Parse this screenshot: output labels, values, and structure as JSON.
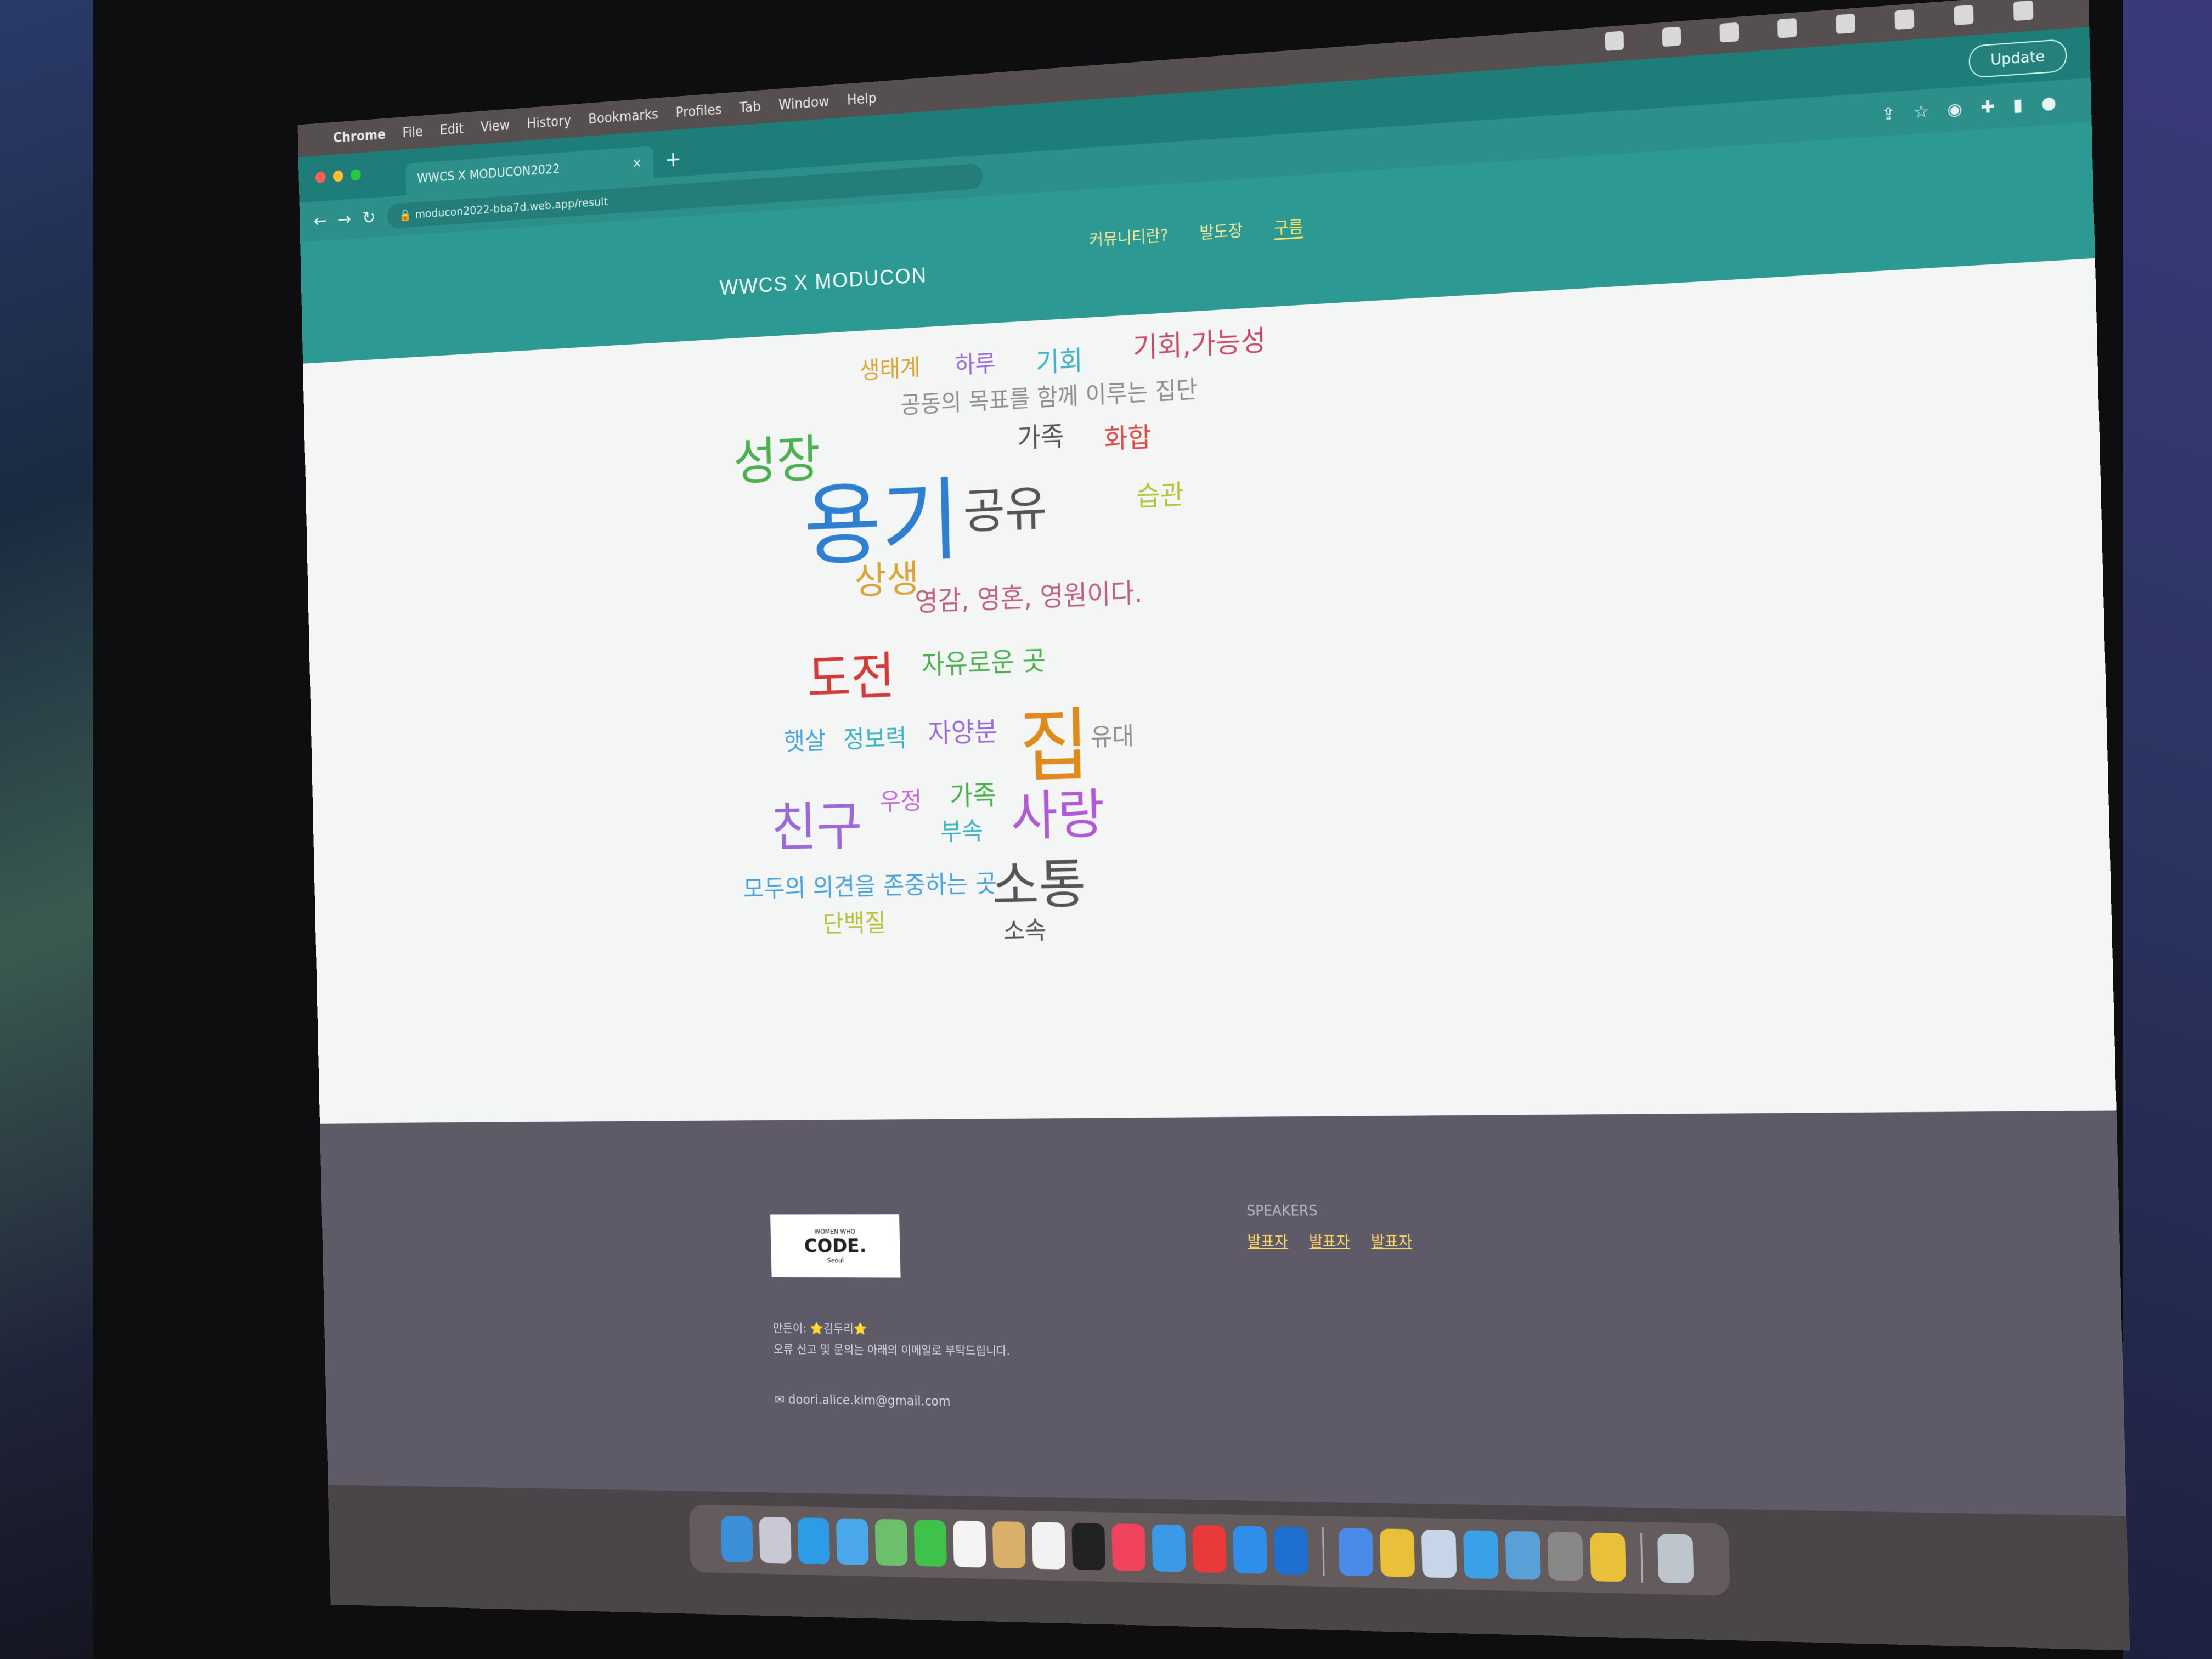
{
  "menubar": {
    "app_name": "Chrome",
    "items": [
      "File",
      "Edit",
      "View",
      "History",
      "Bookmarks",
      "Profiles",
      "Tab",
      "Window",
      "Help"
    ]
  },
  "browser": {
    "tab_title": "WWCS X MODUCON2022",
    "url": "moducon2022-bba7d.web.app/result",
    "update_label": "Update"
  },
  "site": {
    "title": "WWCS X MODUCON",
    "nav": [
      "커뮤니티란?",
      "발도장",
      "구름"
    ],
    "active_nav": "구름"
  },
  "word_cloud": [
    {
      "text": "생태계",
      "color": "#d9a53a"
    },
    {
      "text": "하루",
      "color": "#9b6ad6"
    },
    {
      "text": "기회",
      "color": "#3fb3c4"
    },
    {
      "text": "기회,가능성",
      "color": "#c84a6a"
    },
    {
      "text": "공동의 목표를 함께 이루는 집단",
      "color": "#8f8f8f"
    },
    {
      "text": "성장",
      "color": "#4caf50"
    },
    {
      "text": "용기",
      "color": "#2f7fd0"
    },
    {
      "text": "가족",
      "color": "#555555"
    },
    {
      "text": "화합",
      "color": "#d84a4a"
    },
    {
      "text": "공유",
      "color": "#555555"
    },
    {
      "text": "습관",
      "color": "#b8c23a"
    },
    {
      "text": "상생",
      "color": "#d9a53a"
    },
    {
      "text": "영감, 영혼, 영원이다.",
      "color": "#c0607a"
    },
    {
      "text": "도전",
      "color": "#d43a3a"
    },
    {
      "text": "자유로운 곳",
      "color": "#4caf50"
    },
    {
      "text": "햇살",
      "color": "#4aa3d9"
    },
    {
      "text": "정보력",
      "color": "#3fb3c4"
    },
    {
      "text": "자양분",
      "color": "#9b6ad6"
    },
    {
      "text": "집",
      "color": "#e08a1e"
    },
    {
      "text": "유대",
      "color": "#8f8f8f"
    },
    {
      "text": "친구",
      "color": "#9b6ad6"
    },
    {
      "text": "우정",
      "color": "#c46ad6"
    },
    {
      "text": "가족",
      "color": "#4caf50"
    },
    {
      "text": "사랑",
      "color": "#b05ad6"
    },
    {
      "text": "부속",
      "color": "#3fb3c4"
    },
    {
      "text": "모두의 의견을 존중하는 곳",
      "color": "#4aa3d9"
    },
    {
      "text": "소통",
      "color": "#555555"
    },
    {
      "text": "단백질",
      "color": "#b8c23a"
    },
    {
      "text": "소속",
      "color": "#555555"
    }
  ],
  "footer": {
    "logo_small": "WOMEN WHO",
    "logo_big": "CODE.",
    "logo_sub": "Seoul",
    "speakers_title": "SPEAKERS",
    "speakers": [
      "발표자",
      "발표자",
      "발표자"
    ],
    "credit": "만든이: ⭐김두리⭐",
    "note": "오류 신고 및 문의는 아래의 이메일로 부탁드립니다.",
    "email": "doori.alice.kim@gmail.com"
  },
  "colors": {
    "theme": "#2c9a93",
    "footer": "#5f5a68",
    "page_bg": "#f3f6f4"
  }
}
